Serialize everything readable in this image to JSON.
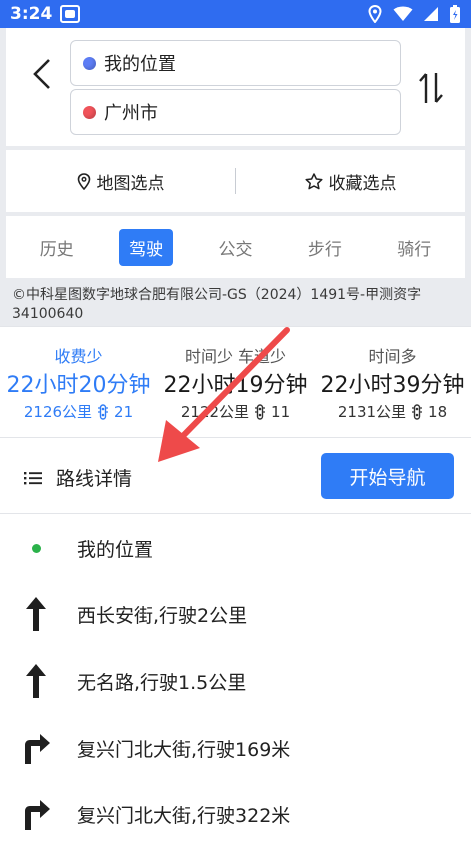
{
  "status_bar": {
    "time": "3:24"
  },
  "search": {
    "from": "我的位置",
    "to": "广州市"
  },
  "pick": {
    "map_pick": "地图选点",
    "fav_pick": "收藏选点"
  },
  "modes": [
    "历史",
    "驾驶",
    "公交",
    "步行",
    "骑行"
  ],
  "active_mode": "驾驶",
  "copyright": "©中科星图数字地球合肥有限公司-GS（2024）1491号-甲测资字34100640",
  "routes": [
    {
      "label": "收费少",
      "duration": "22小时20分钟",
      "distance": "2126公里",
      "lights": "21"
    },
    {
      "label": "时间少  车道少",
      "duration": "22小时19分钟",
      "distance": "2122公里",
      "lights": "11"
    },
    {
      "label": "时间多",
      "duration": "22小时39分钟",
      "distance": "2131公里",
      "lights": "18"
    }
  ],
  "detail": {
    "title": "路线详情",
    "start_nav": "开始导航"
  },
  "steps": [
    {
      "icon": "location-dot-icon",
      "text": "我的位置"
    },
    {
      "icon": "straight-arrow-icon",
      "text": "西长安街,行驶2公里"
    },
    {
      "icon": "straight-arrow-icon",
      "text": "无名路,行驶1.5公里"
    },
    {
      "icon": "turn-right-icon",
      "text": "复兴门北大街,行驶169米"
    },
    {
      "icon": "turn-right-icon",
      "text": "复兴门北大街,行驶322米"
    }
  ],
  "colors": {
    "status_bar": "#2f6cf0",
    "accent": "#2f7cf6",
    "annotation_arrow": "#ee4a4a",
    "from_dot": "#5d7df5",
    "to_dot": "#f0535a",
    "start_dot": "#2bb24a"
  }
}
